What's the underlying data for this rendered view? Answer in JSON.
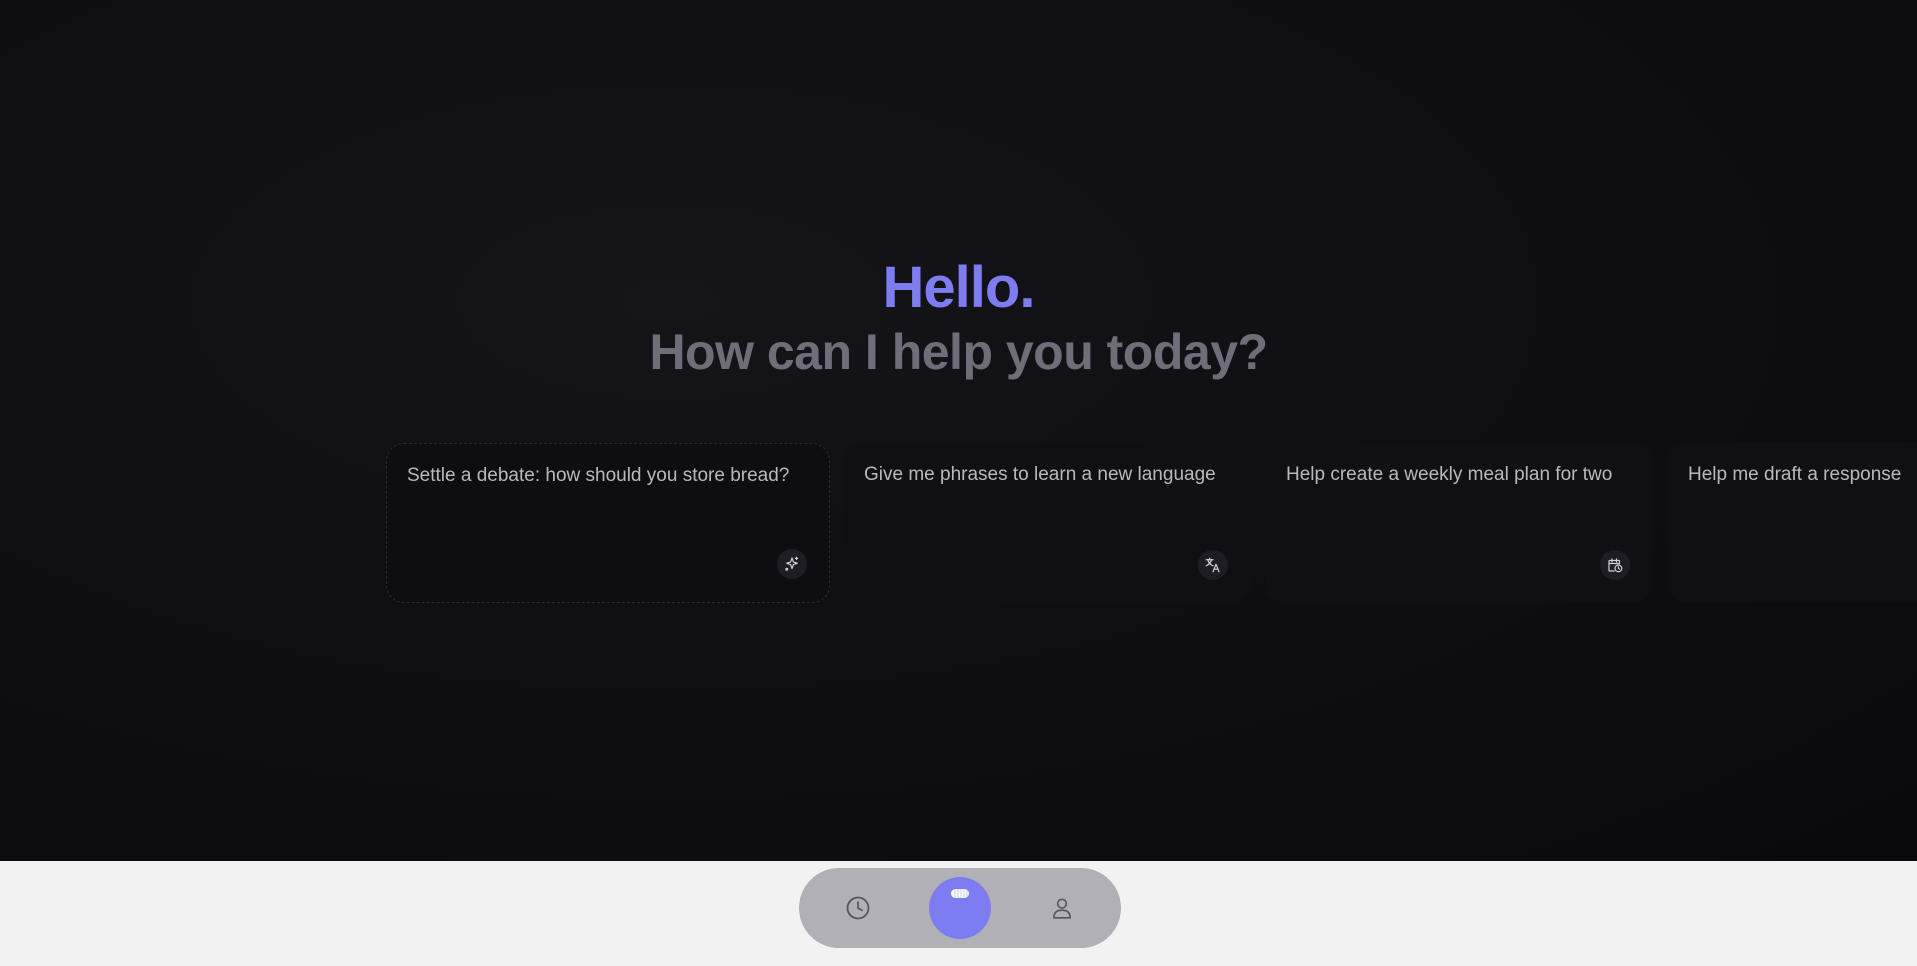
{
  "greeting": {
    "hello": "Hello.",
    "subtitle": "How can I help you today?"
  },
  "suggestions": [
    {
      "text": "Settle a debate: how should you store bread?",
      "icon": "sparkles-icon"
    },
    {
      "text": "Give me phrases to learn a new language",
      "icon": "translate-icon"
    },
    {
      "text": "Help create a weekly meal plan for two",
      "icon": "calendar-clock-icon"
    },
    {
      "text": "Help me draft a response",
      "icon": "pencil-icon"
    }
  ],
  "nav": {
    "items": [
      {
        "icon": "history-clock-icon"
      },
      {
        "icon": "assistant-orb-icon"
      },
      {
        "icon": "profile-icon"
      }
    ]
  },
  "colors": {
    "accent": "#7d7cf0",
    "background": "#0c0c10",
    "card": "#101014",
    "subtitle": "#6f6e78",
    "card_text": "#b8b8bf",
    "bottom_bar": "#f2f2f2",
    "nav_pill": "#b1b0b6"
  }
}
